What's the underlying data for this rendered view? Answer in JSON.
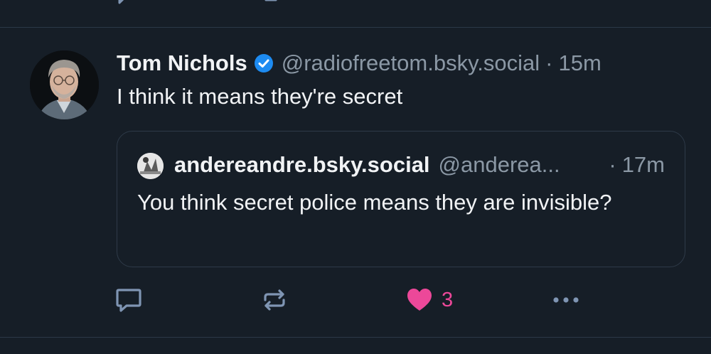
{
  "post": {
    "author_name": "Tom Nichols",
    "verified": true,
    "handle": "@radiofreetom.bsky.social",
    "separator": "·",
    "time": "15m",
    "text": "I think it means they're secret"
  },
  "quote": {
    "author_name": "andereandre.bsky.social",
    "handle": "@anderea...",
    "separator": "·",
    "time": "17m",
    "text": "You think secret police means they are invisible?"
  },
  "actions": {
    "reply_icon": "reply-icon",
    "repost_icon": "repost-icon",
    "like_icon": "heart-icon",
    "like_count": "3",
    "more_icon": "more-options-icon"
  },
  "colors": {
    "background": "#161e27",
    "text": "#f1f3f5",
    "muted": "#8b98a5",
    "verified": "#1d8bf1",
    "like": "#ec4899",
    "icon": "#7f95b3"
  }
}
